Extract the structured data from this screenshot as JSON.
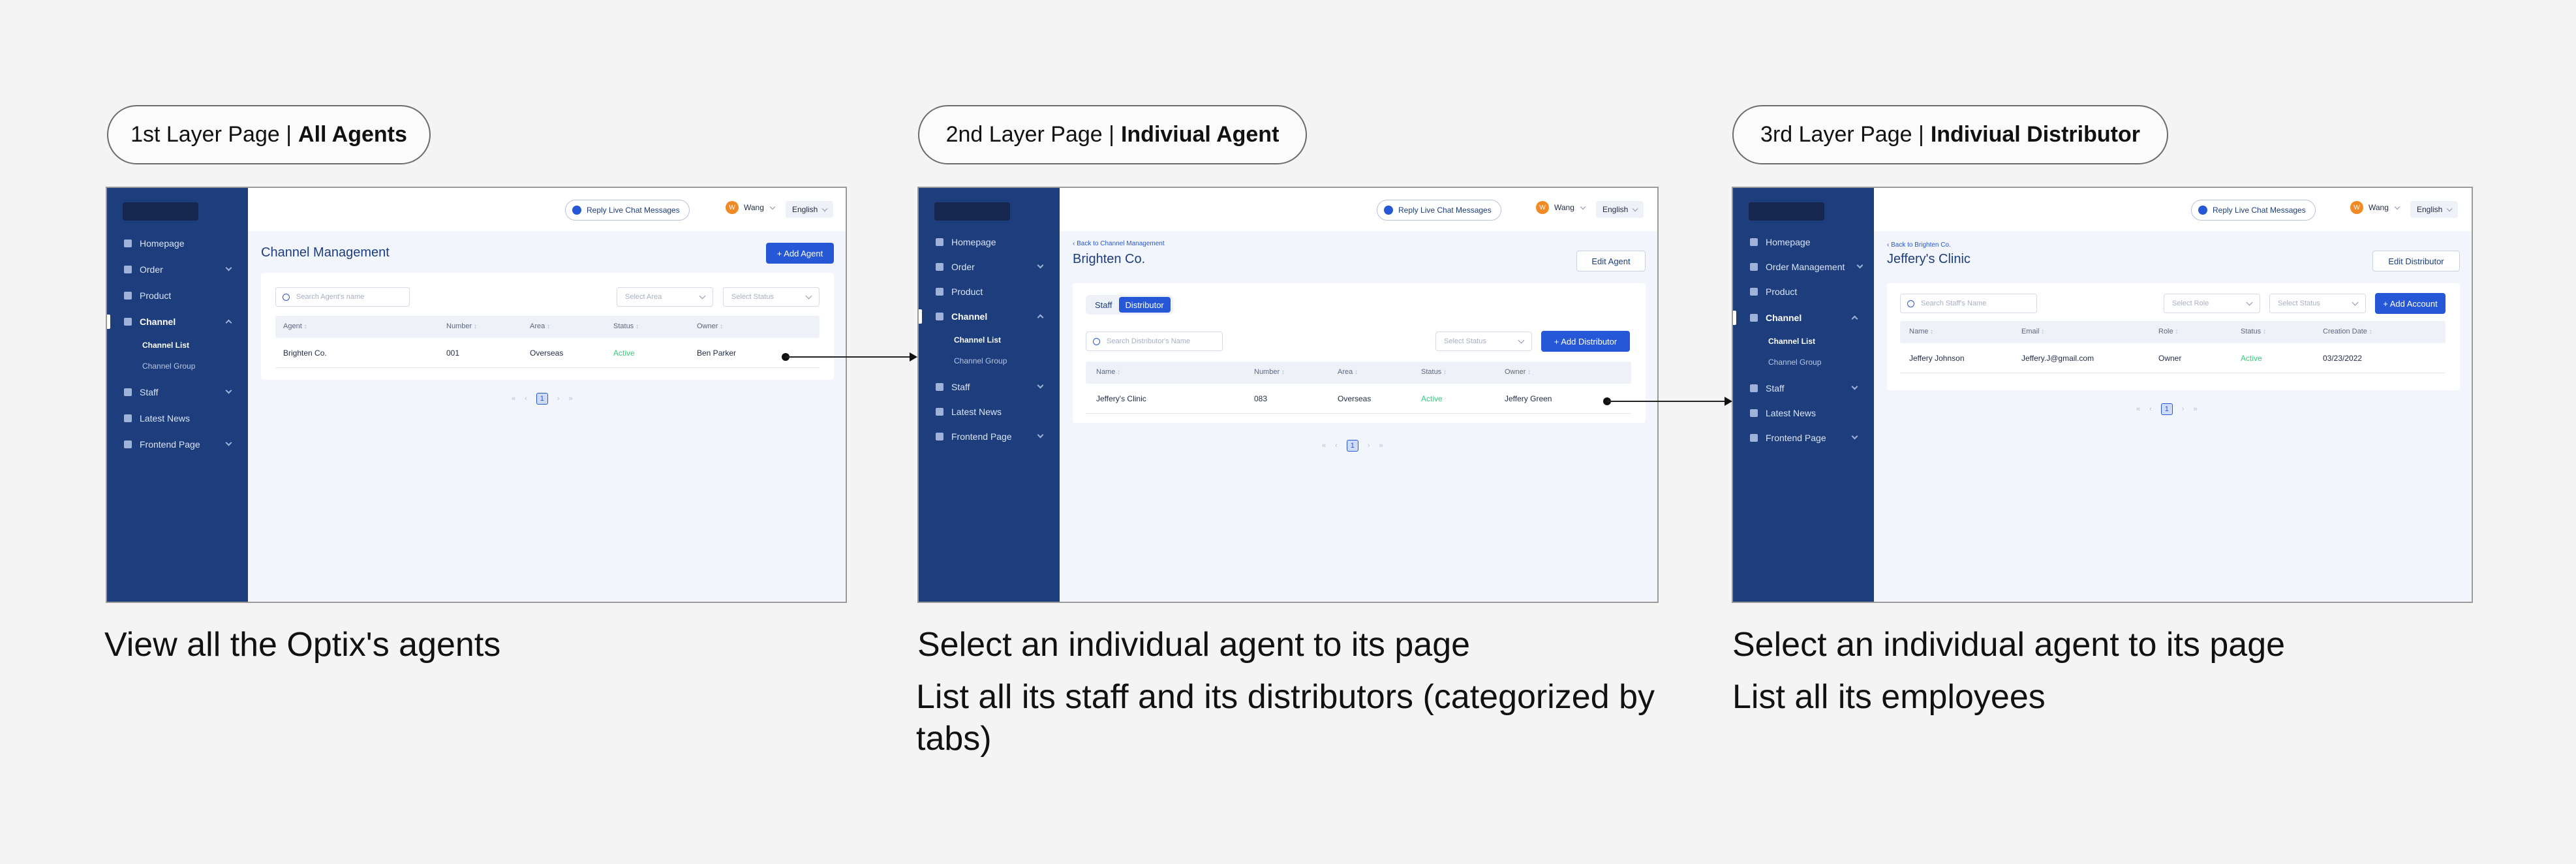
{
  "pills": [
    {
      "prefix": "1st Layer Page | ",
      "bold": "All Agents"
    },
    {
      "prefix": "2nd Layer Page | ",
      "bold": "Indiviual Agent"
    },
    {
      "prefix": "3rd Layer Page | ",
      "bold": "Indiviual Distributor"
    }
  ],
  "common": {
    "reply": "Reply Live Chat Messages",
    "user_initial": "W",
    "user": "Wang",
    "lang": "English",
    "nav": {
      "homepage": "Homepage",
      "order": "Order",
      "order_mgmt": "Order Management",
      "product": "Product",
      "channel": "Channel",
      "channel_list": "Channel List",
      "channel_group": "Channel Group",
      "staff": "Staff",
      "latest_news": "Latest News",
      "frontend": "Frontend Page"
    }
  },
  "screen1": {
    "title": "Channel Management",
    "add_btn": "+ Add Agent",
    "search": "Search Agent's name",
    "sel1": "Select Area",
    "sel2": "Select Status",
    "headers": [
      "Agent",
      "Number",
      "Area",
      "Status",
      "Owner"
    ],
    "row": [
      "Brighten Co.",
      "001",
      "Overseas",
      "Active",
      "Ben Parker"
    ],
    "pager": {
      "first": "«",
      "prev": "‹",
      "page": "1",
      "next": "›",
      "last": "»"
    }
  },
  "screen2": {
    "back": "‹ Back to Channel Management",
    "title": "Brighten Co.",
    "edit_btn": "Edit Agent",
    "tab_staff": "Staff",
    "tab_dist": "Distributor",
    "search": "Search Distributor's Name",
    "sel": "Select Status",
    "add_btn": "+ Add Distributor",
    "headers": [
      "Name",
      "Number",
      "Area",
      "Status",
      "Owner"
    ],
    "row": [
      "Jeffery's Clinic",
      "083",
      "Overseas",
      "Active",
      "Jeffery Green"
    ],
    "pager": {
      "first": "«",
      "prev": "‹",
      "page": "1",
      "next": "›",
      "last": "»"
    }
  },
  "screen3": {
    "back": "‹ Back to Brighten Co.",
    "title": "Jeffery's Clinic",
    "edit_btn": "Edit Distributor",
    "search": "Search Staff's Name",
    "sel1": "Select Role",
    "sel2": "Select Status",
    "add_btn": "+ Add Account",
    "headers": [
      "Name",
      "Email",
      "Role",
      "Status",
      "Creation Date"
    ],
    "row": [
      "Jeffery Johnson",
      "Jeffery.J@gmail.com",
      "Owner",
      "Active",
      "03/23/2022"
    ],
    "pager": {
      "first": "«",
      "prev": "‹",
      "page": "1",
      "next": "›",
      "last": "»"
    }
  },
  "captions": {
    "c1": "View all the Optix's agents",
    "c2a": "Select an individual agent to its page",
    "c2b": "List all its staff and its distributors (categorized by tabs)",
    "c3a": "Select an individual agent to its page",
    "c3b": "List all its employees"
  }
}
